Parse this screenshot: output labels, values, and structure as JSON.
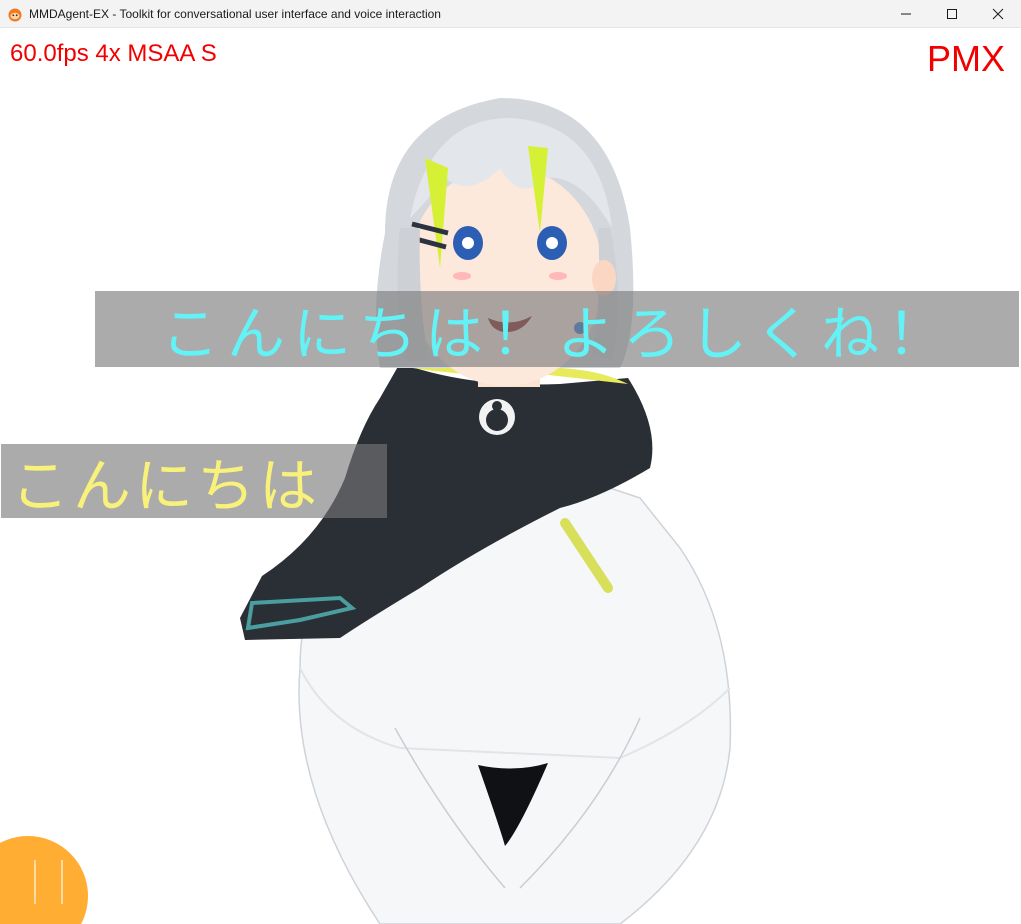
{
  "window": {
    "title": "MMDAgent-EX - Toolkit for conversational user interface and voice interaction",
    "app_icon": "mmdagent-app-icon",
    "controls": [
      "minimize-icon",
      "maximize-icon",
      "close-icon"
    ]
  },
  "overlay": {
    "status": "60.0fps 4x MSAA S",
    "model_type": "PMX",
    "status_color": "#f20000"
  },
  "captions": {
    "agent": "こんにちは！よろしくね！",
    "user": "こんにちは",
    "agent_color": "#63f2f6",
    "user_color": "#f8f27a"
  },
  "scene": {
    "character": "3d-avatar-character",
    "mic_button_color": "#ffad33"
  }
}
